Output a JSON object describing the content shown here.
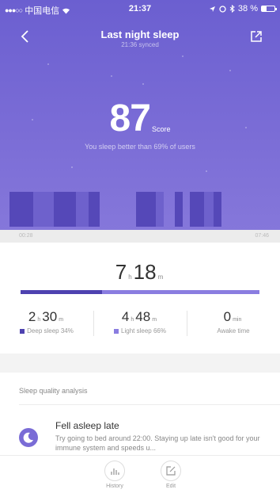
{
  "status_bar": {
    "carrier": "中国电信",
    "time": "21:37",
    "battery": "38 %",
    "battery_level": 0.38
  },
  "header": {
    "title": "Last night sleep",
    "subtitle": "21:36 synced"
  },
  "score": {
    "value": "87",
    "label": "Score",
    "comparison": "You sleep better than 69% of users"
  },
  "timeline": {
    "start_time": "00:28",
    "end_time": "07:46"
  },
  "total": {
    "hours": "7",
    "hours_unit": "h",
    "minutes": "18",
    "minutes_unit": "m",
    "deep_fraction": 0.34
  },
  "stats": {
    "deep": {
      "hours": "2",
      "h_unit": "h",
      "minutes": "30",
      "m_unit": "m",
      "label": "Deep sleep 34%",
      "color": "#4e42b0"
    },
    "light": {
      "hours": "4",
      "h_unit": "h",
      "minutes": "48",
      "m_unit": "m",
      "label": "Light sleep 66%",
      "color": "#8a7de0"
    },
    "awake": {
      "value": "0",
      "unit": "min",
      "label": "Awake time"
    }
  },
  "analysis": {
    "heading": "Sleep quality analysis",
    "items": [
      {
        "icon": "moon-icon",
        "title": "Fell asleep late",
        "text": "Try going to bed around 22:00. Staying up late isn't good for your immune system and speeds u..."
      }
    ]
  },
  "tabbar": {
    "history_label": "History",
    "edit_label": "Edit"
  },
  "colors": {
    "accent": "#7a6cd6",
    "deep": "#4e42b0",
    "light": "#8a7de0"
  }
}
